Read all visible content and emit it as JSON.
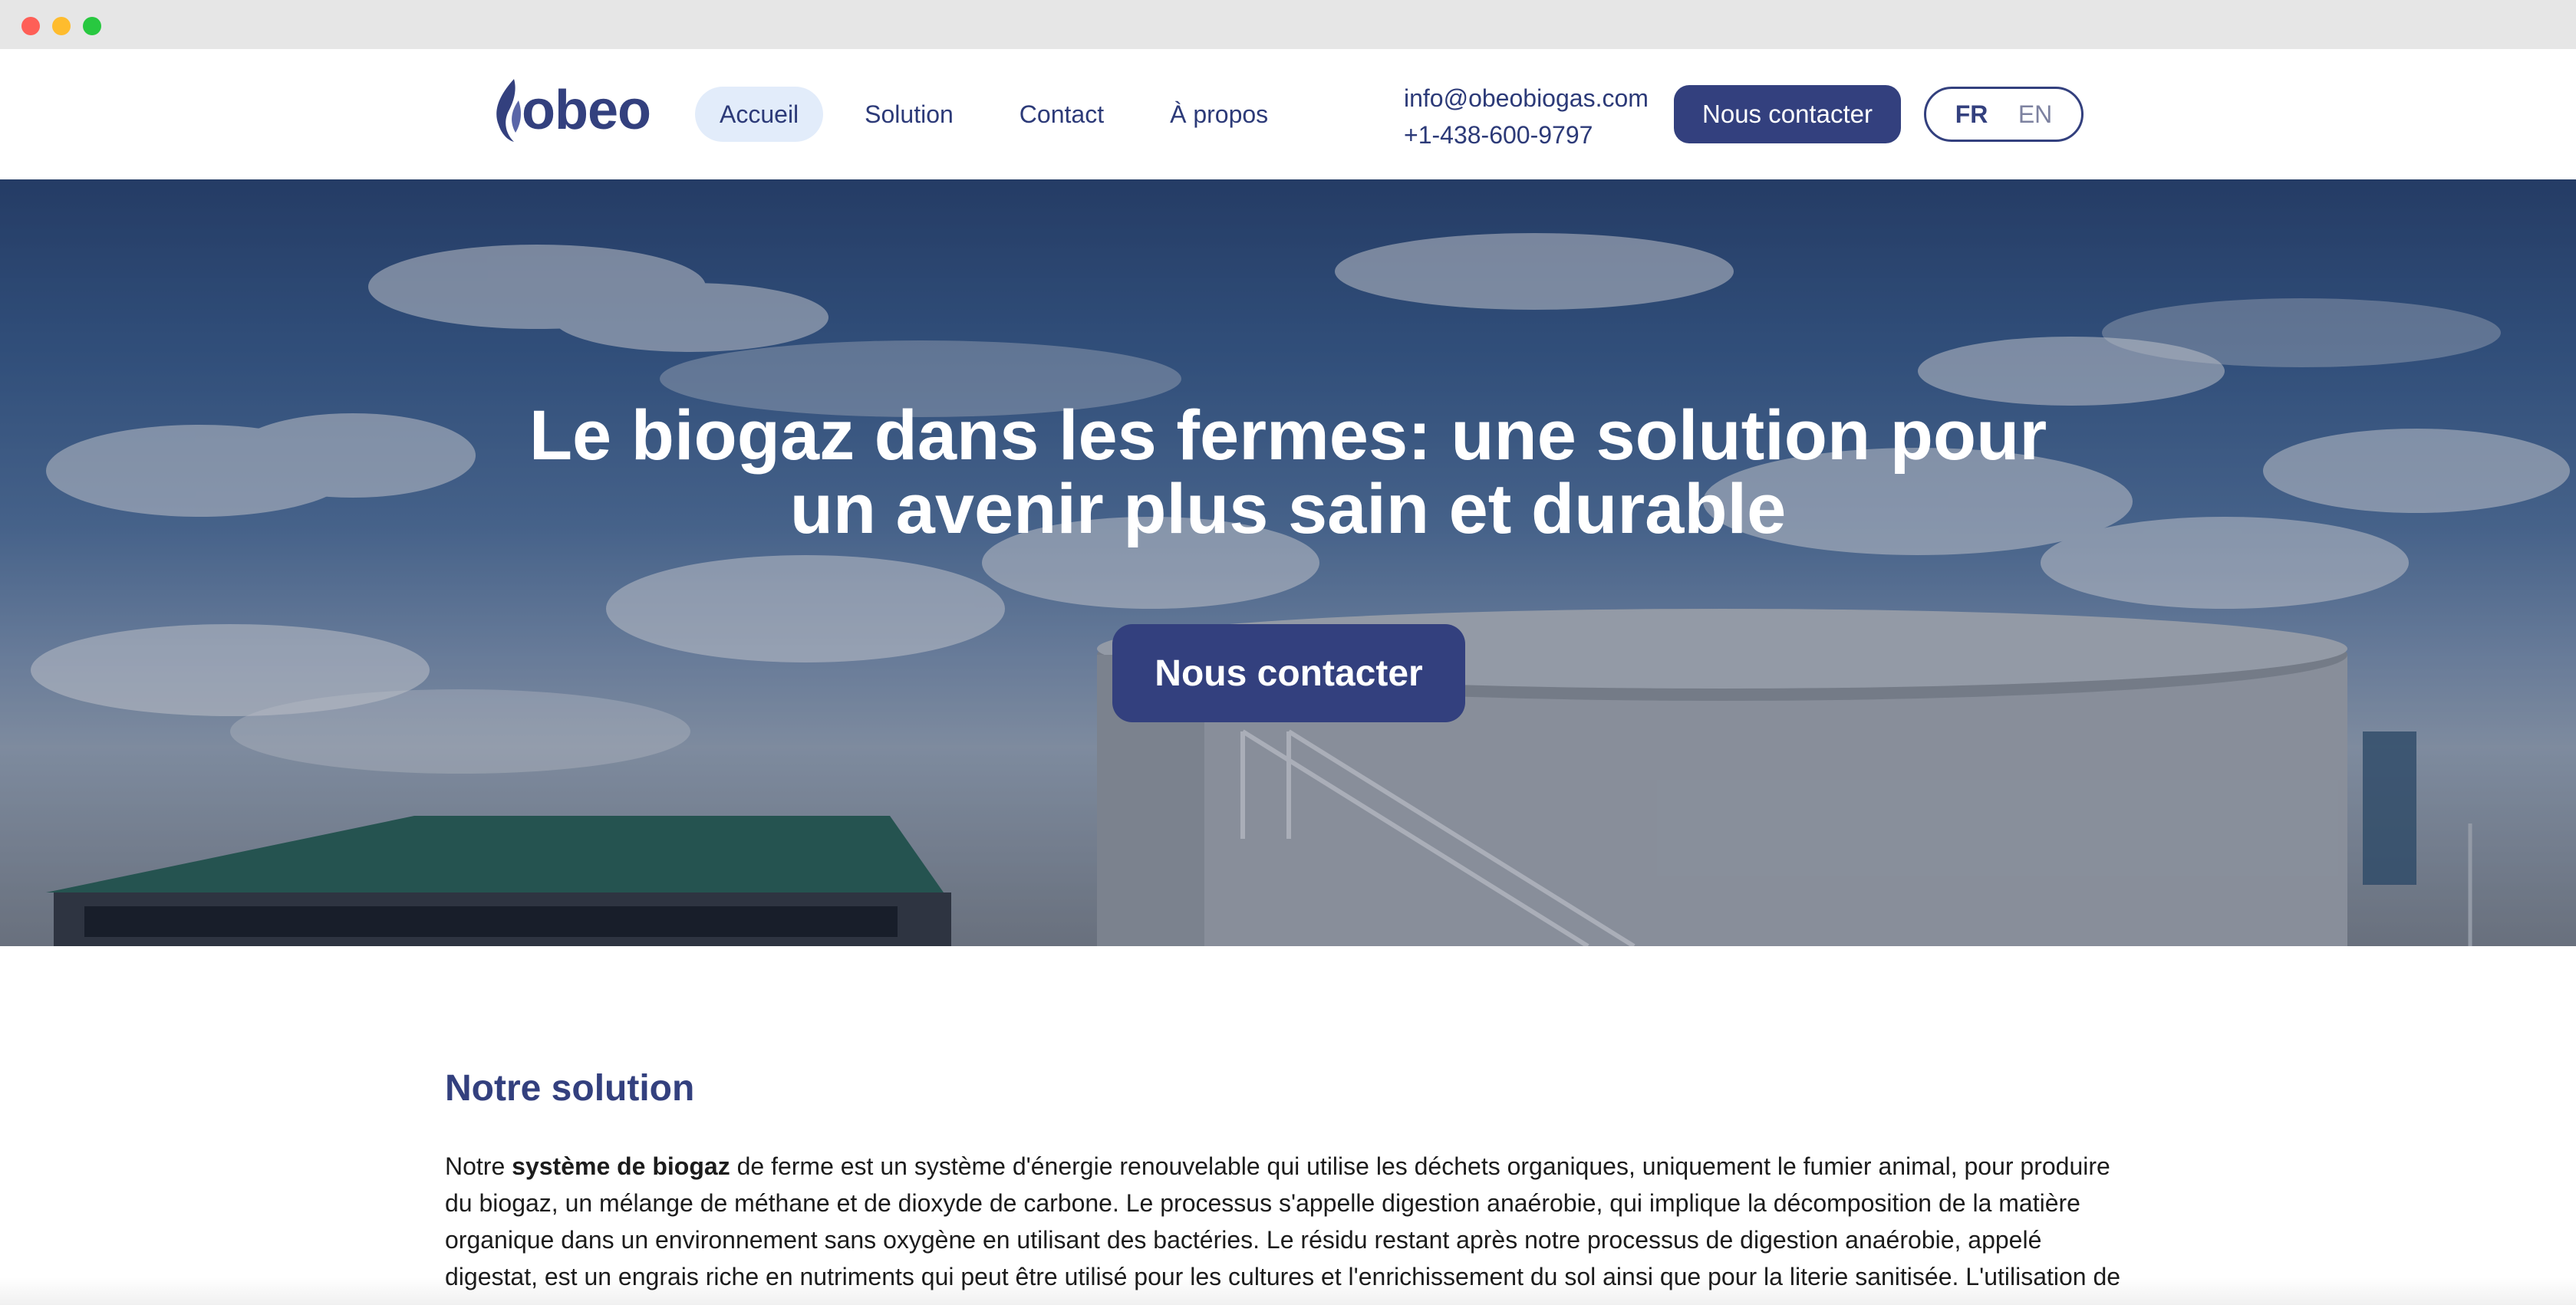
{
  "brand": {
    "name": "obeo",
    "colors": {
      "primary": "#33407e",
      "nav_active_bg": "#e2ecfa",
      "text": "#1c1c1c"
    }
  },
  "nav": {
    "items": [
      {
        "label": "Accueil",
        "active": true
      },
      {
        "label": "Solution",
        "active": false
      },
      {
        "label": "Contact",
        "active": false
      },
      {
        "label": "À propos",
        "active": false
      }
    ]
  },
  "contact": {
    "email": "info@obeobiogas.com",
    "phone": "+1-438-600-9797"
  },
  "header_cta": {
    "label": "Nous contacter"
  },
  "language": {
    "fr": "FR",
    "en": "EN",
    "selected": "FR"
  },
  "hero": {
    "title_line1": "Le biogaz dans les fermes: une solution pour",
    "title_line2": "un avenir plus sain et durable",
    "cta_label": "Nous contacter"
  },
  "solution": {
    "heading": "Notre solution",
    "intro": "Notre ",
    "bold_term": "système de biogaz",
    "paragraph": " de ferme est un système d'énergie renouvelable qui utilise les déchets organiques, uniquement le fumier animal, pour produire du biogaz, un mélange de méthane et de dioxyde de carbone. Le processus s'appelle digestion anaérobie, qui implique la décomposition de la matière organique dans un environnement sans oxygène en utilisant des bactéries. Le résidu restant après notre processus de digestion anaérobie, appelé digestat, est un engrais riche en nutriments qui peut être utilisé pour les cultures et l'enrichissement du sol ainsi que pour la literie sanitisée. L'utilisation de"
  }
}
